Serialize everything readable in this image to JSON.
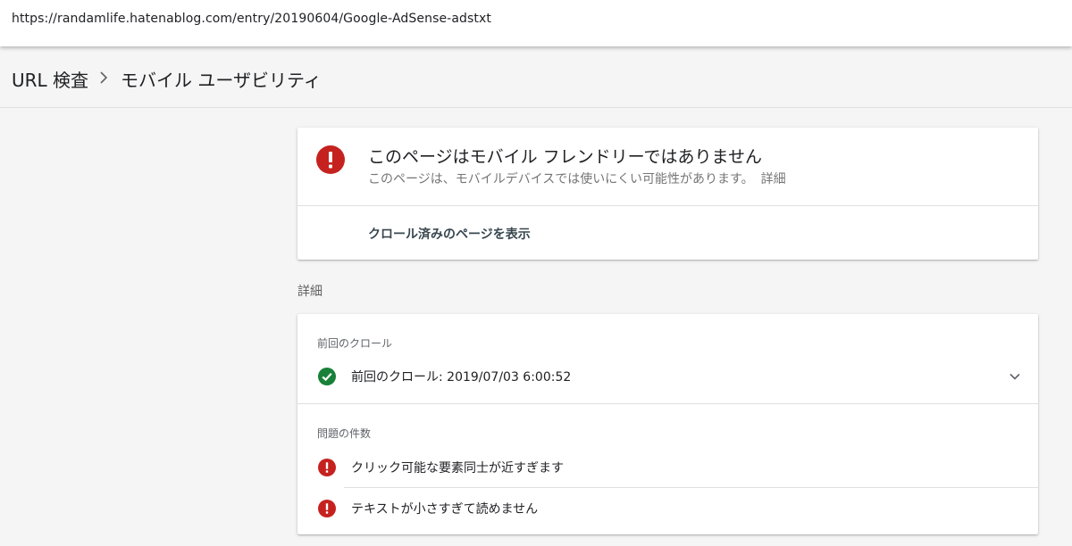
{
  "browser": {
    "url": "https://randamlife.hatenablog.com/entry/20190604/Google-AdSense-adstxt"
  },
  "breadcrumb": {
    "parent": "URL 検査",
    "separator": "›",
    "current": "モバイル ユーザビリティ"
  },
  "status": {
    "icon": "error-icon",
    "title": "このページはモバイル フレンドリーではありません",
    "description": "このページは、モバイルデバイスでは使いにくい可能性があります。",
    "detail_link": "詳細",
    "view_crawled_label": "クロール済みのページを表示",
    "icon_color": "#c5221f"
  },
  "details": {
    "section_label": "詳細",
    "last_crawl_header": "前回のクロール",
    "last_crawl_text": "前回のクロール: 2019/07/03 6:00:52",
    "last_crawl_icon": "check-circle-icon",
    "last_crawl_icon_color": "#188038",
    "issues_header": "問題の件数",
    "issues": [
      {
        "icon": "error-icon",
        "text": "クリック可能な要素同士が近すぎます"
      },
      {
        "icon": "error-icon",
        "text": "テキストが小さすぎて読めません"
      }
    ]
  }
}
